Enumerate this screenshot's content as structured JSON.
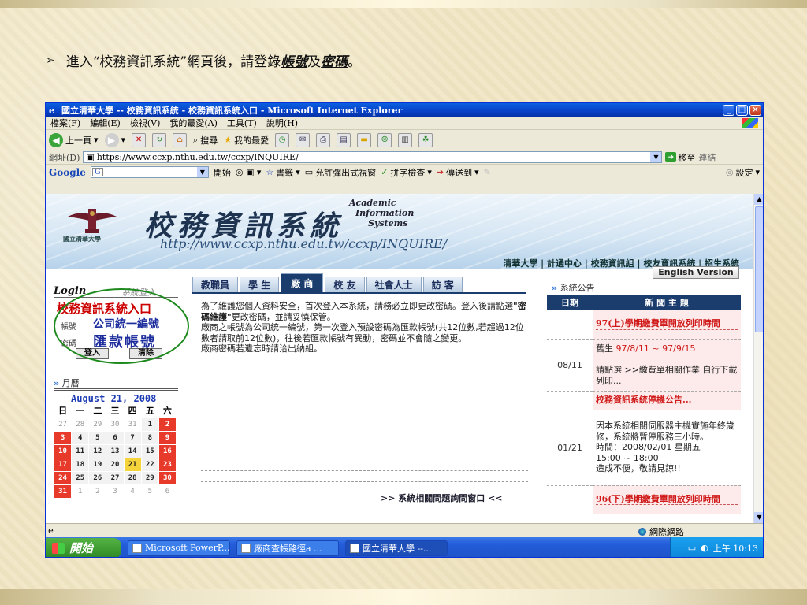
{
  "slide": {
    "bullet": "➢",
    "text_pre": "進入“校務資訊系統”網頁後，請登錄",
    "em1": "帳號",
    "mid": "及",
    "em2": "密碼",
    "end": "。"
  },
  "window": {
    "title": "國立清華大學 -- 校務資訊系統 - 校務資訊系統入口 - Microsoft Internet Explorer"
  },
  "menu": [
    "檔案(F)",
    "編輯(E)",
    "檢視(V)",
    "我的最愛(A)",
    "工具(T)",
    "說明(H)"
  ],
  "toolbar": {
    "back": "上一頁",
    "search": "搜尋",
    "favorites": "我的最愛"
  },
  "address": {
    "label": "網址(D)",
    "url": "https://www.ccxp.nthu.edu.tw/ccxp/INQUIRE/",
    "go": "移至",
    "links": "連結"
  },
  "google": {
    "logo": "Google",
    "g": "G",
    "start": "開始",
    "bookmarks": "書籤",
    "popup": "允許彈出式視窗",
    "spell": "拼字檢查",
    "send": "傳送到",
    "settings": "設定"
  },
  "banner": {
    "univ_small": "國立清華大學",
    "title": "校務資訊系統",
    "url": "http://www.ccxp.nthu.edu.tw/ccxp/INQUIRE/",
    "academic": "Academic",
    "information": "Information",
    "systems": "Systems",
    "links": "清華大學 | 計通中心 | 校務資訊組 | 校友資訊系統 | 招生系統"
  },
  "login": {
    "head_en": "Login",
    "head_cn": "系統登入",
    "title": "校務資訊系統入口",
    "account_label": "帳號",
    "account_value": "公司統一編號",
    "password_label": "密碼",
    "password_value": "匯款帳號",
    "login_btn": "登入",
    "clear_btn": "清除"
  },
  "calendar": {
    "label": "月曆",
    "month": "August 21, 2008",
    "weekdays": [
      "日",
      "一",
      "二",
      "三",
      "四",
      "五",
      "六"
    ],
    "rows": [
      [
        "27",
        "28",
        "29",
        "30",
        "31",
        "1",
        "2"
      ],
      [
        "3",
        "4",
        "5",
        "6",
        "7",
        "8",
        "9"
      ],
      [
        "10",
        "11",
        "12",
        "13",
        "14",
        "15",
        "16"
      ],
      [
        "17",
        "18",
        "19",
        "20",
        "21",
        "22",
        "23"
      ],
      [
        "24",
        "25",
        "26",
        "27",
        "28",
        "29",
        "30"
      ],
      [
        "31",
        "1",
        "2",
        "3",
        "4",
        "5",
        "6"
      ]
    ]
  },
  "tabs": [
    "教職員",
    "學 生",
    "廠 商",
    "校 友",
    "社會人士",
    "訪 客"
  ],
  "announce": {
    "p1": "為了維護您個人資料安全，首次登入本系統，請務必立即更改密碼。登入後請點選",
    "p1_b": "\"密碼維護\"",
    "p1_end": "更改密碼，並請妥慎保管。",
    "p2": "廠商之帳號為公司統一編號，第一次登入預設密碼為匯款帳號(共12位數,若超過12位數者請取前12位數)，往後若匯款帳號有異動，密碼並不會隨之變更。",
    "p3": "廠商密碼若遺忘時請洽出納組。",
    "faq": ">> 系統相關問題詢問窗口 <<"
  },
  "news": {
    "label": "系統公告",
    "english": "English Version",
    "col_date": "日期",
    "col_title": "新 聞 主 題",
    "items": [
      {
        "date": "",
        "title": "97(上)學期繳費單開放列印時間",
        "lines": []
      },
      {
        "date": "08/11",
        "title": "",
        "lines": [
          "舊生 97/8/11 ~ 97/9/15",
          "請點選  >>繳費單相關作業 自行下載列印..."
        ]
      },
      {
        "date": "",
        "title": "校務資訊系統停機公告...",
        "lines": []
      },
      {
        "date": "01/21",
        "title": "",
        "lines": [
          "因本系統相關伺服器主機實施年終歲修，系統將暫停服務三小時。",
          "時間：2008/02/01 星期五",
          "15:00 ~ 18:00",
          "造成不便，敬請見諒!!"
        ]
      },
      {
        "date": "",
        "title": "96(下)學期繳費單開放列印時間",
        "lines": []
      }
    ]
  },
  "status": {
    "zone": "網際網路"
  },
  "taskbar": {
    "start": "開始",
    "tasks": [
      "Microsoft PowerP...",
      "廠商查帳路徑a ...",
      "國立清華大學 --..."
    ],
    "time": "上午 10:13"
  }
}
